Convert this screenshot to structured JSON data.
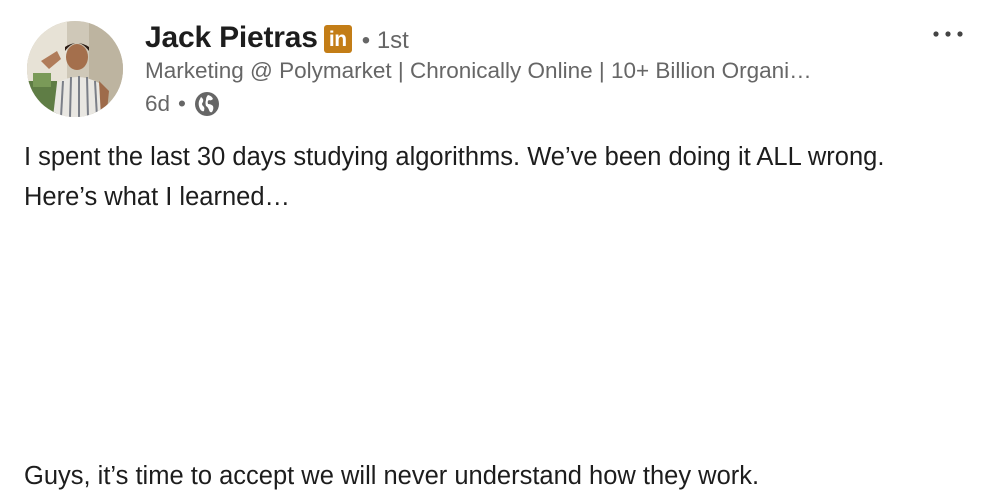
{
  "author": {
    "name": "Jack Pietras",
    "badge_icon": "linkedin-premium-icon",
    "badge_label": "in",
    "badge_color": "#c37d16",
    "connection_degree": "• 1st",
    "headline": "Marketing @ Polymarket | Chronically Online | 10+ Billion Organi…",
    "post_age": "6d",
    "visibility_separator": "•",
    "visibility_icon": "globe-icon"
  },
  "menu": {
    "icon": "more-horizontal-icon"
  },
  "post": {
    "text_paragraph_1": "I spent the last 30 days studying algorithms. We’ve been doing it ALL wrong. Here’s what I learned…",
    "text_paragraph_2": "Guys, it’s time to accept we will never understand how they work."
  }
}
